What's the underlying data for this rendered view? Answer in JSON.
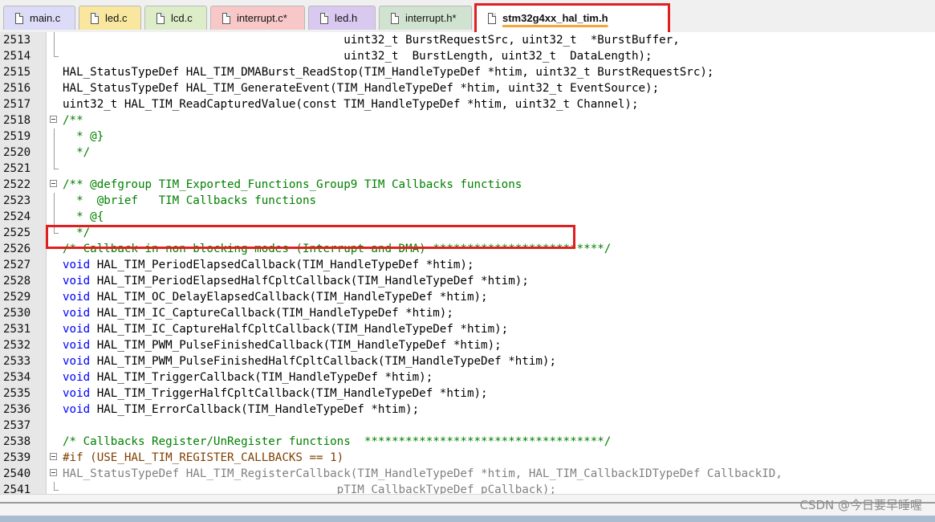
{
  "tabs": [
    {
      "label": "main.c",
      "color": "#dcdcf8"
    },
    {
      "label": "led.c",
      "color": "#f9e79f"
    },
    {
      "label": "lcd.c",
      "color": "#dcedc8"
    },
    {
      "label": "interrupt.c*",
      "color": "#f8c8c8"
    },
    {
      "label": "led.h",
      "color": "#d9c8f0"
    },
    {
      "label": "interrupt.h*",
      "color": "#cfe3d0"
    },
    {
      "label": "stm32g4xx_hal_tim.h",
      "color": "#ffffff"
    }
  ],
  "active_tab_index": 6,
  "highlight_color": "#e02020",
  "lines": [
    {
      "num": "2513",
      "text": "                                         uint32_t BurstRequestSrc, uint32_t  *BurstBuffer,",
      "style": "plain",
      "fold": "line"
    },
    {
      "num": "2514",
      "text": "                                         uint32_t  BurstLength, uint32_t  DataLength);",
      "style": "plain",
      "fold": "end"
    },
    {
      "num": "2515",
      "text": "HAL_StatusTypeDef HAL_TIM_DMABurst_ReadStop(TIM_HandleTypeDef *htim, uint32_t BurstRequestSrc);",
      "style": "plain",
      "fold": ""
    },
    {
      "num": "2516",
      "text": "HAL_StatusTypeDef HAL_TIM_GenerateEvent(TIM_HandleTypeDef *htim, uint32_t EventSource);",
      "style": "plain",
      "fold": ""
    },
    {
      "num": "2517",
      "text": "uint32_t HAL_TIM_ReadCapturedValue(const TIM_HandleTypeDef *htim, uint32_t Channel);",
      "style": "plain",
      "fold": ""
    },
    {
      "num": "2518",
      "text": "/**",
      "style": "comment",
      "fold": "start"
    },
    {
      "num": "2519",
      "text": "  * @}",
      "style": "comment",
      "fold": "line"
    },
    {
      "num": "2520",
      "text": "  */",
      "style": "comment",
      "fold": "line"
    },
    {
      "num": "2521",
      "text": "",
      "style": "plain",
      "fold": "end"
    },
    {
      "num": "2522",
      "text": "/** @defgroup TIM_Exported_Functions_Group9 TIM Callbacks functions",
      "style": "comment",
      "fold": "start"
    },
    {
      "num": "2523",
      "text": "  *  @brief   TIM Callbacks functions",
      "style": "comment",
      "fold": "line"
    },
    {
      "num": "2524",
      "text": "  * @{",
      "style": "comment",
      "fold": "line"
    },
    {
      "num": "2525",
      "text": "  */",
      "style": "comment",
      "fold": "end"
    },
    {
      "num": "2526",
      "text": "/* Callback in non blocking modes (Interrupt and DMA) *************************/",
      "style": "comment",
      "fold": ""
    },
    {
      "num": "2527",
      "text": "void HAL_TIM_PeriodElapsedCallback(TIM_HandleTypeDef *htim);",
      "style": "void",
      "fold": ""
    },
    {
      "num": "2528",
      "text": "void HAL_TIM_PeriodElapsedHalfCpltCallback(TIM_HandleTypeDef *htim);",
      "style": "void",
      "fold": ""
    },
    {
      "num": "2529",
      "text": "void HAL_TIM_OC_DelayElapsedCallback(TIM_HandleTypeDef *htim);",
      "style": "void",
      "fold": ""
    },
    {
      "num": "2530",
      "text": "void HAL_TIM_IC_CaptureCallback(TIM_HandleTypeDef *htim);",
      "style": "void",
      "fold": ""
    },
    {
      "num": "2531",
      "text": "void HAL_TIM_IC_CaptureHalfCpltCallback(TIM_HandleTypeDef *htim);",
      "style": "void",
      "fold": ""
    },
    {
      "num": "2532",
      "text": "void HAL_TIM_PWM_PulseFinishedCallback(TIM_HandleTypeDef *htim);",
      "style": "void",
      "fold": ""
    },
    {
      "num": "2533",
      "text": "void HAL_TIM_PWM_PulseFinishedHalfCpltCallback(TIM_HandleTypeDef *htim);",
      "style": "void",
      "fold": ""
    },
    {
      "num": "2534",
      "text": "void HAL_TIM_TriggerCallback(TIM_HandleTypeDef *htim);",
      "style": "void",
      "fold": ""
    },
    {
      "num": "2535",
      "text": "void HAL_TIM_TriggerHalfCpltCallback(TIM_HandleTypeDef *htim);",
      "style": "void",
      "fold": ""
    },
    {
      "num": "2536",
      "text": "void HAL_TIM_ErrorCallback(TIM_HandleTypeDef *htim);",
      "style": "void",
      "fold": ""
    },
    {
      "num": "2537",
      "text": "",
      "style": "plain",
      "fold": ""
    },
    {
      "num": "2538",
      "text": "/* Callbacks Register/UnRegister functions  ***********************************/",
      "style": "comment",
      "fold": ""
    },
    {
      "num": "2539",
      "text": "#if (USE_HAL_TIM_REGISTER_CALLBACKS == 1)",
      "style": "pre",
      "fold": "start"
    },
    {
      "num": "2540",
      "text": "HAL_StatusTypeDef HAL_TIM_RegisterCallback(TIM_HandleTypeDef *htim, HAL_TIM_CallbackIDTypeDef CallbackID,",
      "style": "gray",
      "fold": "start"
    },
    {
      "num": "2541",
      "text": "                                        pTIM_CallbackTypeDef pCallback);",
      "style": "gray",
      "fold": "end"
    }
  ],
  "watermark": "CSDN @今日要早睡喔"
}
